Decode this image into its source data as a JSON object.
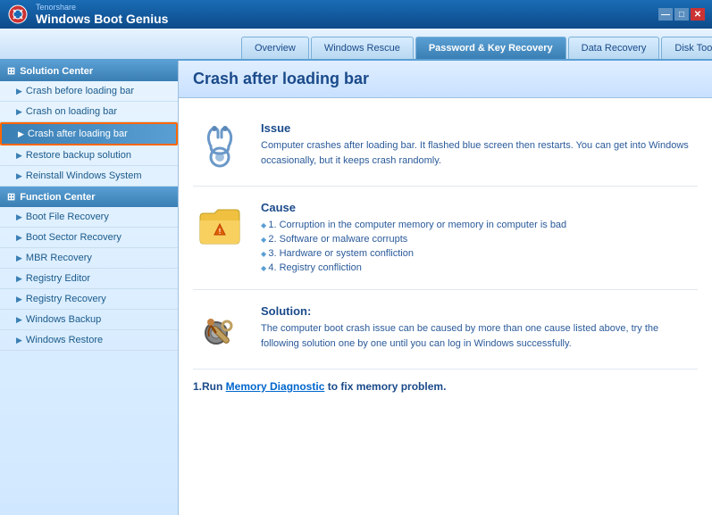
{
  "titleBar": {
    "company": "Tenorshare",
    "appName": "Windows Boot Genius",
    "controls": {
      "minimize": "—",
      "maximize": "□",
      "close": "✕"
    }
  },
  "navTabs": [
    {
      "id": "overview",
      "label": "Overview",
      "active": false
    },
    {
      "id": "windows-rescue",
      "label": "Windows Rescue",
      "active": false
    },
    {
      "id": "password-recovery",
      "label": "Password & Key Recovery",
      "active": true
    },
    {
      "id": "data-recovery",
      "label": "Data Recovery",
      "active": false
    },
    {
      "id": "disk-tools",
      "label": "Disk Tools",
      "active": false
    }
  ],
  "sidebar": {
    "solutionCenter": {
      "header": "Solution Center",
      "items": [
        {
          "id": "crash-before",
          "label": "Crash before loading bar",
          "active": false
        },
        {
          "id": "crash-on",
          "label": "Crash on loading bar",
          "active": false
        },
        {
          "id": "crash-after",
          "label": "Crash after loading bar",
          "active": true
        },
        {
          "id": "restore-backup",
          "label": "Restore backup solution",
          "active": false
        },
        {
          "id": "reinstall-windows",
          "label": "Reinstall Windows System",
          "active": false
        }
      ]
    },
    "functionCenter": {
      "header": "Function Center",
      "items": [
        {
          "id": "boot-file",
          "label": "Boot File Recovery",
          "active": false
        },
        {
          "id": "boot-sector",
          "label": "Boot Sector Recovery",
          "active": false
        },
        {
          "id": "mbr",
          "label": "MBR Recovery",
          "active": false
        },
        {
          "id": "registry-editor",
          "label": "Registry Editor",
          "active": false
        },
        {
          "id": "registry-recovery",
          "label": "Registry Recovery",
          "active": false
        },
        {
          "id": "windows-backup",
          "label": "Windows Backup",
          "active": false
        },
        {
          "id": "windows-restore",
          "label": "Windows Restore",
          "active": false
        }
      ]
    }
  },
  "content": {
    "title": "Crash after loading bar",
    "sections": {
      "issue": {
        "title": "Issue",
        "text": "Computer crashes after loading bar. It flashed blue screen then restarts. You can get into Windows occasionally, but it keeps crash randomly."
      },
      "cause": {
        "title": "Cause",
        "items": [
          "1. Corruption in the computer memory or memory in computer is bad",
          "2. Software or malware corrupts",
          "3. Hardware or system confliction",
          "4. Registry confliction"
        ]
      },
      "solution": {
        "title": "Solution:",
        "text": "The computer boot crash issue can be caused by more than one cause listed above, try the following solution one by one until you can log in Windows successfully."
      },
      "step1": {
        "label": "1.Run ",
        "linkText": "Memory Diagnostic",
        "suffix": " to fix memory problem."
      }
    }
  }
}
